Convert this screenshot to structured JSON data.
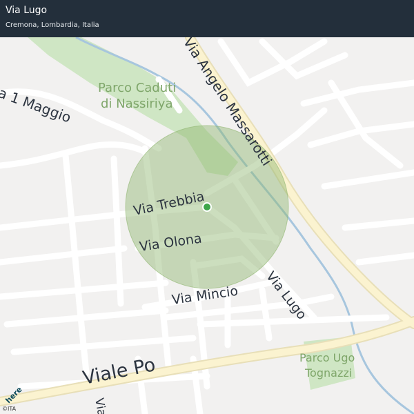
{
  "header": {
    "title": "Via Lugo",
    "subtitle": "Cremona, Lombardia, Italia"
  },
  "map": {
    "streets": {
      "primo_maggio": "a 1 Maggio",
      "angelo_massarotti": "Via Angelo Massarotti",
      "trebbia": "Via Trebbia",
      "olona": "Via Olona",
      "mincio": "Via Mincio",
      "lugo": "Via Lugo",
      "viale_po": "Viale Po",
      "partial_bottom": "Via"
    },
    "parks": {
      "nassiriya_line1": "Parco Caduti",
      "nassiriya_line2": "di Nassiriya",
      "tognazzi_line1": "Parco Ugo",
      "tognazzi_line2": "Tognazzi"
    },
    "logo": "here",
    "copyright": "©ITA",
    "colors": {
      "land": "#f2f1f0",
      "park": "#cfe6c4",
      "river": "#8fb9d9",
      "main_road": "#fbf3d0",
      "location_dot": "#3ea64a",
      "accuracy_circle": "#8fb56f",
      "header_bg": "#232f3b"
    },
    "icons": [
      "location-dot-icon",
      "here-logo-icon"
    ]
  }
}
